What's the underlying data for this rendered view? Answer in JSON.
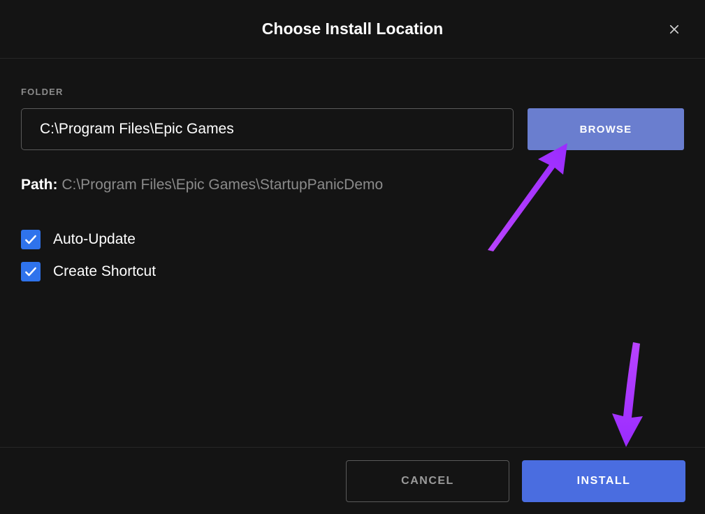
{
  "header": {
    "title": "Choose Install Location"
  },
  "folder": {
    "label": "FOLDER",
    "value": "C:\\Program Files\\Epic Games",
    "browse_label": "BROWSE"
  },
  "path": {
    "label": "Path:",
    "value": "C:\\Program Files\\Epic Games\\StartupPanicDemo"
  },
  "options": {
    "auto_update": "Auto-Update",
    "create_shortcut": "Create Shortcut"
  },
  "footer": {
    "cancel_label": "CANCEL",
    "install_label": "INSTALL"
  }
}
